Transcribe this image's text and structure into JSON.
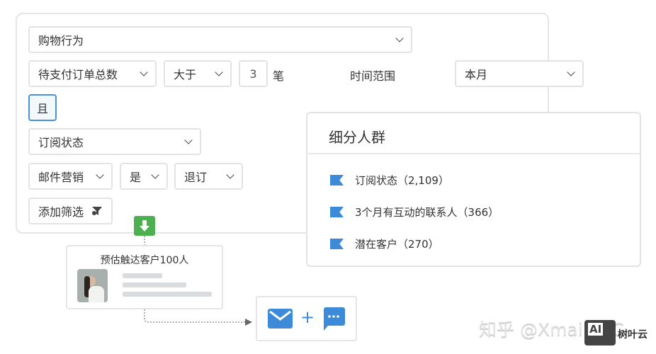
{
  "filters": {
    "category": "购物行为",
    "metric": "待支付订单总数",
    "operator": "大于",
    "count": "3",
    "unit": "笔",
    "time_label": "时间范围",
    "time_value": "本月",
    "and_button": "且",
    "subscription": "订阅状态",
    "channel": "邮件营销",
    "is_value": "是",
    "status": "退订",
    "add_filter": "添加筛选"
  },
  "estimate": {
    "title": "预估触达客户100人"
  },
  "segments": {
    "title": "细分人群",
    "items": [
      {
        "label": "订阅状态（2,109）"
      },
      {
        "label": "3个月有互动的联系人（366）"
      },
      {
        "label": "潜在客户（270）"
      }
    ]
  },
  "watermark": {
    "text": "知乎 @Xmail_ITC",
    "logo": "AI",
    "brand": "树叶云"
  },
  "colors": {
    "accent": "#3d8bd8",
    "green": "#4caf50"
  }
}
